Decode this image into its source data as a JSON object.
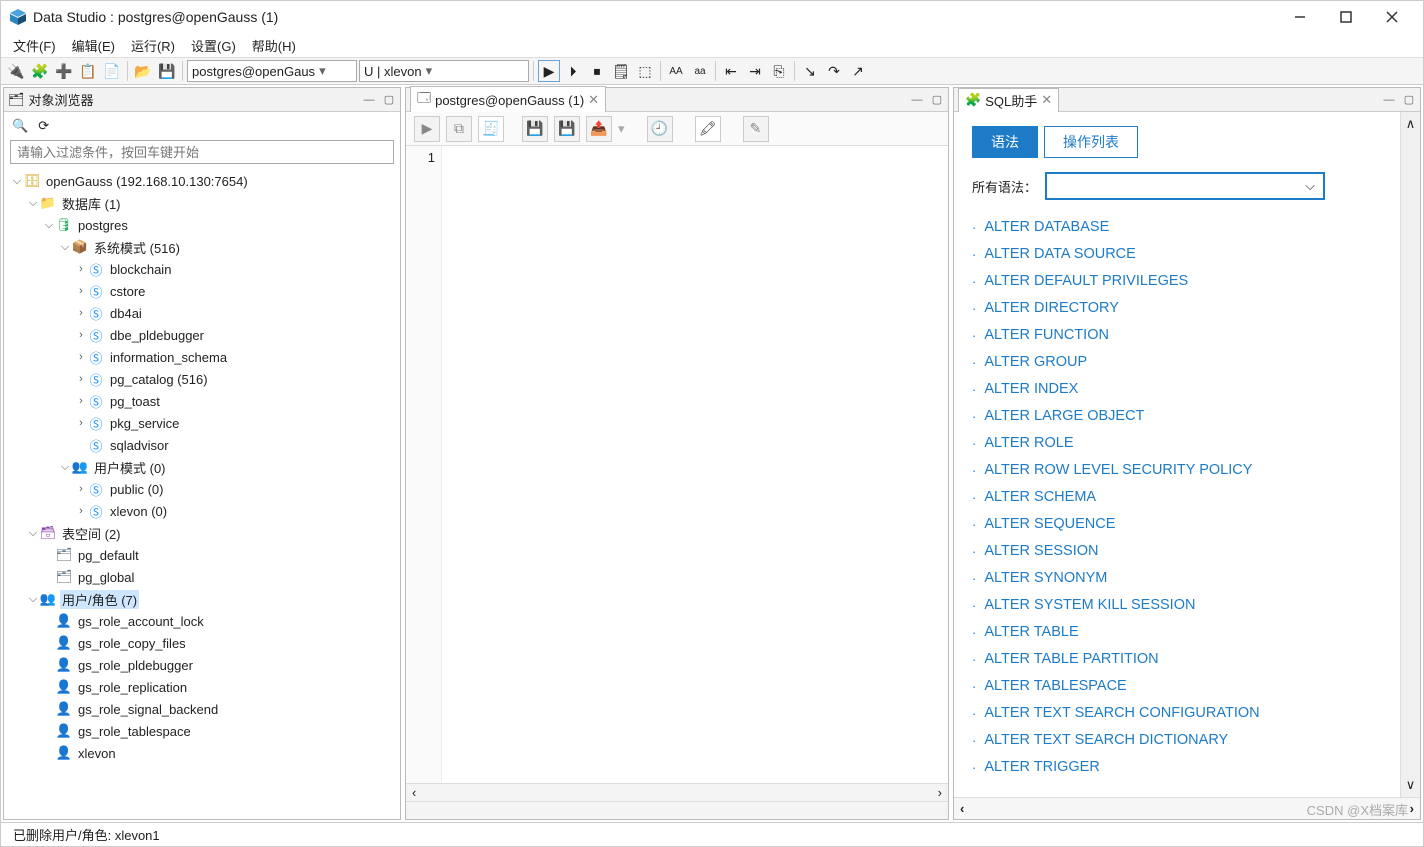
{
  "window": {
    "title": "Data Studio : postgres@openGauss (1)"
  },
  "menu": [
    "文件(F)",
    "编辑(E)",
    "运行(R)",
    "设置(G)",
    "帮助(H)"
  ],
  "toolbar": {
    "combo1": "postgres@openGaus",
    "combo2": "U | xlevon"
  },
  "objectBrowser": {
    "title": "对象浏览器",
    "filterPlaceholder": "请输入过滤条件，按回车键开始",
    "tree": [
      {
        "d": 0,
        "exp": "v",
        "icon": "db",
        "label": "openGauss (192.168.10.130:7654)"
      },
      {
        "d": 1,
        "exp": "v",
        "icon": "folder",
        "label": "数据库 (1)"
      },
      {
        "d": 2,
        "exp": "v",
        "icon": "dbg",
        "label": "postgres"
      },
      {
        "d": 3,
        "exp": "v",
        "icon": "schema",
        "label": "系统模式 (516)"
      },
      {
        "d": 4,
        "exp": ">",
        "icon": "s",
        "label": "blockchain"
      },
      {
        "d": 4,
        "exp": ">",
        "icon": "s",
        "label": "cstore"
      },
      {
        "d": 4,
        "exp": ">",
        "icon": "s",
        "label": "db4ai"
      },
      {
        "d": 4,
        "exp": ">",
        "icon": "s",
        "label": "dbe_pldebugger"
      },
      {
        "d": 4,
        "exp": ">",
        "icon": "s",
        "label": "information_schema"
      },
      {
        "d": 4,
        "exp": ">",
        "icon": "s",
        "label": "pg_catalog (516)"
      },
      {
        "d": 4,
        "exp": ">",
        "icon": "s",
        "label": "pg_toast"
      },
      {
        "d": 4,
        "exp": ">",
        "icon": "s",
        "label": "pkg_service"
      },
      {
        "d": 4,
        "exp": "",
        "icon": "s",
        "label": "sqladvisor"
      },
      {
        "d": 3,
        "exp": "v",
        "icon": "users",
        "label": "用户模式 (0)"
      },
      {
        "d": 4,
        "exp": ">",
        "icon": "s",
        "label": "public (0)"
      },
      {
        "d": 4,
        "exp": ">",
        "icon": "s",
        "label": "xlevon (0)"
      },
      {
        "d": 1,
        "exp": "v",
        "icon": "ts",
        "label": "表空间 (2)"
      },
      {
        "d": 2,
        "exp": "",
        "icon": "tsi",
        "label": "pg_default"
      },
      {
        "d": 2,
        "exp": "",
        "icon": "tsi",
        "label": "pg_global"
      },
      {
        "d": 1,
        "exp": "v",
        "icon": "roles",
        "label": "用户/角色 (7)",
        "sel": true
      },
      {
        "d": 2,
        "exp": "",
        "icon": "role",
        "label": "gs_role_account_lock"
      },
      {
        "d": 2,
        "exp": "",
        "icon": "role",
        "label": "gs_role_copy_files"
      },
      {
        "d": 2,
        "exp": "",
        "icon": "role",
        "label": "gs_role_pldebugger"
      },
      {
        "d": 2,
        "exp": "",
        "icon": "role",
        "label": "gs_role_replication"
      },
      {
        "d": 2,
        "exp": "",
        "icon": "role",
        "label": "gs_role_signal_backend"
      },
      {
        "d": 2,
        "exp": "",
        "icon": "role",
        "label": "gs_role_tablespace"
      },
      {
        "d": 2,
        "exp": "",
        "icon": "roleg",
        "label": "xlevon"
      }
    ]
  },
  "editor": {
    "tab": "postgres@openGauss (1)",
    "line": "1"
  },
  "sqlHelper": {
    "title": "SQL助手",
    "tabs": [
      "语法",
      "操作列表"
    ],
    "filterLabel": "所有语法：",
    "items": [
      "ALTER DATABASE",
      "ALTER DATA SOURCE",
      "ALTER DEFAULT PRIVILEGES",
      "ALTER DIRECTORY",
      "ALTER FUNCTION",
      "ALTER GROUP",
      "ALTER INDEX",
      "ALTER LARGE OBJECT",
      "ALTER ROLE",
      "ALTER ROW LEVEL SECURITY POLICY",
      "ALTER SCHEMA",
      "ALTER SEQUENCE",
      "ALTER SESSION",
      "ALTER SYNONYM",
      "ALTER SYSTEM KILL SESSION",
      "ALTER TABLE",
      "ALTER TABLE PARTITION",
      "ALTER TABLESPACE",
      "ALTER TEXT SEARCH CONFIGURATION",
      "ALTER TEXT SEARCH DICTIONARY",
      "ALTER TRIGGER"
    ]
  },
  "status": "已删除用户/角色: xlevon1",
  "watermark": "CSDN @X档案库"
}
